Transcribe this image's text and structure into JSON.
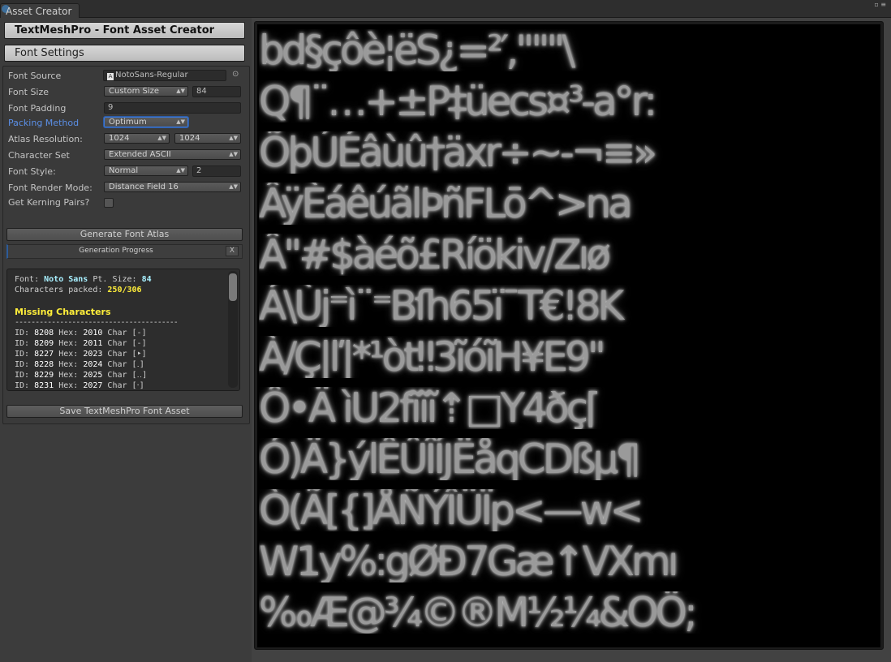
{
  "window": {
    "tab_title": "Asset Creator",
    "controls": "▫ ≡"
  },
  "header": {
    "title": "TextMeshPro - Font Asset Creator",
    "section": "Font Settings"
  },
  "settings": {
    "font_source": {
      "label": "Font Source",
      "value": "NotoSans-Regular",
      "picker": "⊙"
    },
    "font_size": {
      "label": "Font Size",
      "mode": "Custom Size",
      "value": "84"
    },
    "font_padding": {
      "label": "Font Padding",
      "value": "9"
    },
    "packing_method": {
      "label": "Packing Method",
      "value": "Optimum"
    },
    "atlas_resolution": {
      "label": "Atlas Resolution:",
      "width": "1024",
      "height": "1024"
    },
    "character_set": {
      "label": "Character Set",
      "value": "Extended ASCII"
    },
    "font_style": {
      "label": "Font Style:",
      "value": "Normal",
      "modifier": "2"
    },
    "render_mode": {
      "label": "Font Render Mode:",
      "value": "Distance Field 16"
    },
    "kerning": {
      "label": "Get Kerning Pairs?",
      "checked": false
    }
  },
  "actions": {
    "generate": "Generate Font Atlas",
    "progress_label": "Generation Progress",
    "progress_close": "X",
    "save": "Save TextMeshPro Font Asset"
  },
  "report": {
    "font_label": "Font:",
    "font_name": "Noto Sans",
    "pt_label": "Pt. Size:",
    "pt_size": "84",
    "packed_label": "Characters packed:",
    "packed": "250/306",
    "missing_title": "Missing Characters",
    "separator": "----------------------------------------",
    "missing": [
      {
        "id": "8208",
        "hex": "2010",
        "char": "[‐]"
      },
      {
        "id": "8209",
        "hex": "2011",
        "char": "[‑]"
      },
      {
        "id": "8227",
        "hex": "2023",
        "char": "[‣]"
      },
      {
        "id": "8228",
        "hex": "2024",
        "char": "[․]"
      },
      {
        "id": "8229",
        "hex": "2025",
        "char": "[‥]"
      },
      {
        "id": "8231",
        "hex": "2027",
        "char": "[‧]"
      }
    ]
  },
  "atlas_rows": [
    "bd§çôè¦ëS¿=²′,\"\"\"\\",
    "Q¶¨…+±P‡üecs¤³-a°r:",
    "ÕþÚÉâùû†äxr÷~-¬≡»",
    "ÂÿÈáêúãlÞñFLō^>na",
    "Â\"#$àéõ£Ríökiv/Zıø",
    "Á\\Ùj⁼ì¨⁼Bſh65ï¯T€!8K",
    "À/Ç|ľ|*¹òt‼3ĩóĩH¥E9\"",
    "Ô•Ä ìU2fĩĩĩ⇡□Y4ðç⌈",
    "Ó)Ä}ýlÊÛÎÍJËåqCDßµ¶",
    "Ò(Ã[{]ÅÑÝÎÜÏp<—w<",
    "W1y%:gØĐ7Gæ↑VXmı",
    "‰Æ@¾©®M½¼&OÖ;"
  ]
}
